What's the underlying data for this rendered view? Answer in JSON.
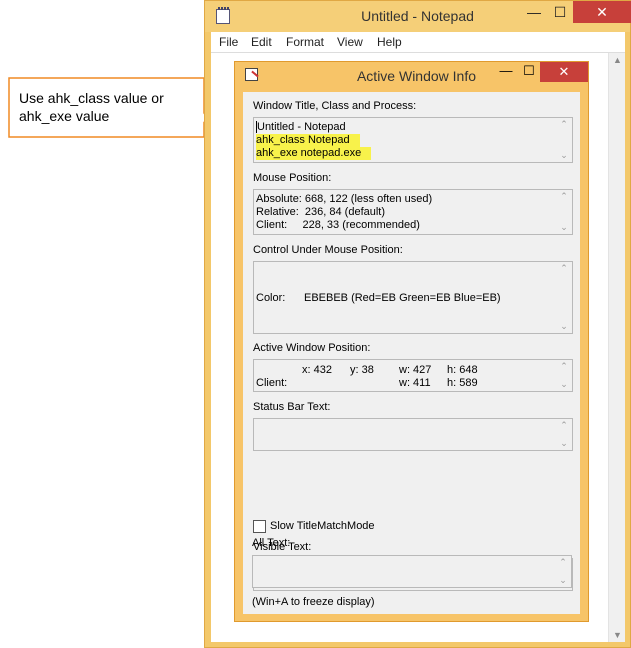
{
  "callout": {
    "line1": "Use ahk_class value or",
    "line2": "ahk_exe value"
  },
  "notepad": {
    "title": "Untitled - Notepad",
    "minimize": "—",
    "maximize": "☐",
    "close": "✕",
    "menu": [
      "File",
      "Edit",
      "Format",
      "View",
      "Help"
    ]
  },
  "awi": {
    "title": "Active Window Info",
    "minimize": "—",
    "maximize": "☐",
    "close": "✕",
    "sections": {
      "window": {
        "label": "Window Title, Class and Process:",
        "lines": [
          "Untitled - Notepad",
          "ahk_class Notepad",
          "ahk_exe notepad.exe"
        ]
      },
      "mouse": {
        "label": "Mouse Position:",
        "lines": [
          "Absolute: 668, 122 (less often used)",
          "Relative:  236, 84 (default)",
          "Client:     228, 33 (recommended)"
        ]
      },
      "control": {
        "label": "Control Under Mouse Position:",
        "color_label": "Color:",
        "color_value": "EBEBEB (Red=EB Green=EB Blue=EB)"
      },
      "active_pos": {
        "label": "Active Window Position:",
        "x": "x: 432",
        "y": "y: 38",
        "w": "w: 427",
        "h": "h: 648",
        "client_label": "Client:",
        "cw": "w: 411",
        "ch": "h: 589"
      },
      "status_bar": {
        "label": "Status Bar Text:"
      },
      "slow_match": {
        "label": "Slow TitleMatchMode",
        "checked": false
      },
      "visible_text": {
        "label": "Visible Text:"
      },
      "all_text": {
        "label": "All Text:"
      },
      "footer": "(Win+A to freeze display)"
    }
  }
}
